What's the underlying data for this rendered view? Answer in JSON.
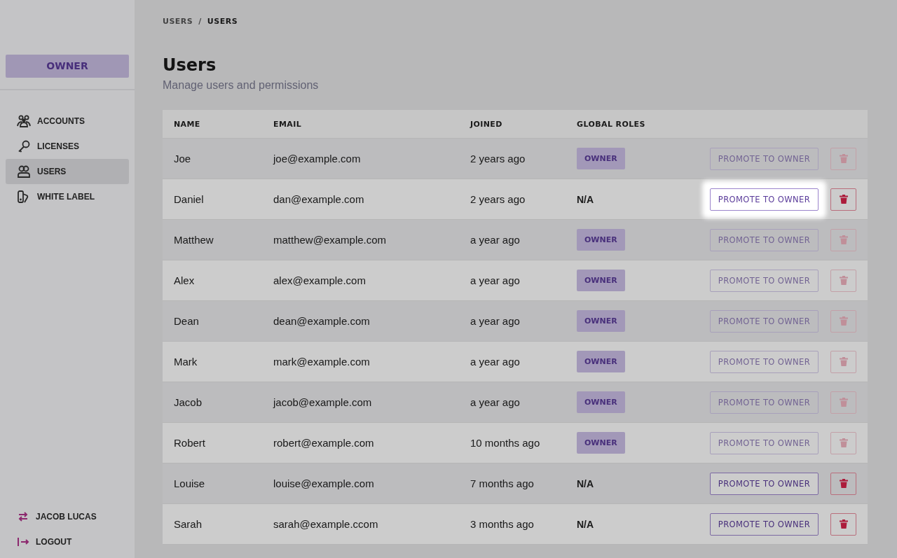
{
  "sidebar": {
    "role_badge": "OWNER",
    "items": [
      {
        "label": "ACCOUNTS",
        "selected": false
      },
      {
        "label": "LICENSES",
        "selected": false
      },
      {
        "label": "USERS",
        "selected": true
      },
      {
        "label": "WHITE LABEL",
        "selected": false
      }
    ],
    "footer": [
      "JACOB LUCAS",
      "LOGOUT"
    ]
  },
  "breadcrumb": [
    "USERS",
    "/",
    "USERS"
  ],
  "page": {
    "title": "Users",
    "subtitle": "Manage users and permissions"
  },
  "table": {
    "columns": [
      "NAME",
      "EMAIL",
      "JOINED",
      "GLOBAL ROLES"
    ],
    "rows": [
      {
        "name": "Joe",
        "email": "joe@example.com",
        "joined": "2 years ago",
        "role": "OWNER",
        "is_owner": true,
        "action": "PROMOTE TO OWNER",
        "disabled": true,
        "spotlight": false
      },
      {
        "name": "Daniel",
        "email": "dan@example.com",
        "joined": "2 years ago",
        "role": "N/A",
        "is_owner": false,
        "action": "PROMOTE TO OWNER",
        "disabled": false,
        "spotlight": true
      },
      {
        "name": "Matthew",
        "email": "matthew@example.com",
        "joined": "a year ago",
        "role": "OWNER",
        "is_owner": true,
        "action": "PROMOTE TO OWNER",
        "disabled": true,
        "spotlight": false
      },
      {
        "name": "Alex",
        "email": "alex@example.com",
        "joined": "a year ago",
        "role": "OWNER",
        "is_owner": true,
        "action": "PROMOTE TO OWNER",
        "disabled": true,
        "spotlight": false
      },
      {
        "name": "Dean",
        "email": "dean@example.com",
        "joined": "a year ago",
        "role": "OWNER",
        "is_owner": true,
        "action": "PROMOTE TO OWNER",
        "disabled": true,
        "spotlight": false
      },
      {
        "name": "Mark",
        "email": "mark@example.com",
        "joined": "a year ago",
        "role": "OWNER",
        "is_owner": true,
        "action": "PROMOTE TO OWNER",
        "disabled": true,
        "spotlight": false
      },
      {
        "name": "Jacob",
        "email": "jacob@example.com",
        "joined": "a year ago",
        "role": "OWNER",
        "is_owner": true,
        "action": "PROMOTE TO OWNER",
        "disabled": true,
        "spotlight": false
      },
      {
        "name": "Robert",
        "email": "robert@example.com",
        "joined": "10 months ago",
        "role": "OWNER",
        "is_owner": true,
        "action": "PROMOTE TO OWNER",
        "disabled": true,
        "spotlight": false
      },
      {
        "name": "Louise",
        "email": "louise@example.com",
        "joined": "7 months ago",
        "role": "N/A",
        "is_owner": false,
        "action": "PROMOTE TO OWNER",
        "disabled": false,
        "spotlight": false
      },
      {
        "name": "Sarah",
        "email": "sarah@example.ccom",
        "joined": "3 months ago",
        "role": "N/A",
        "is_owner": false,
        "action": "PROMOTE TO OWNER",
        "disabled": false,
        "spotlight": false
      }
    ]
  }
}
